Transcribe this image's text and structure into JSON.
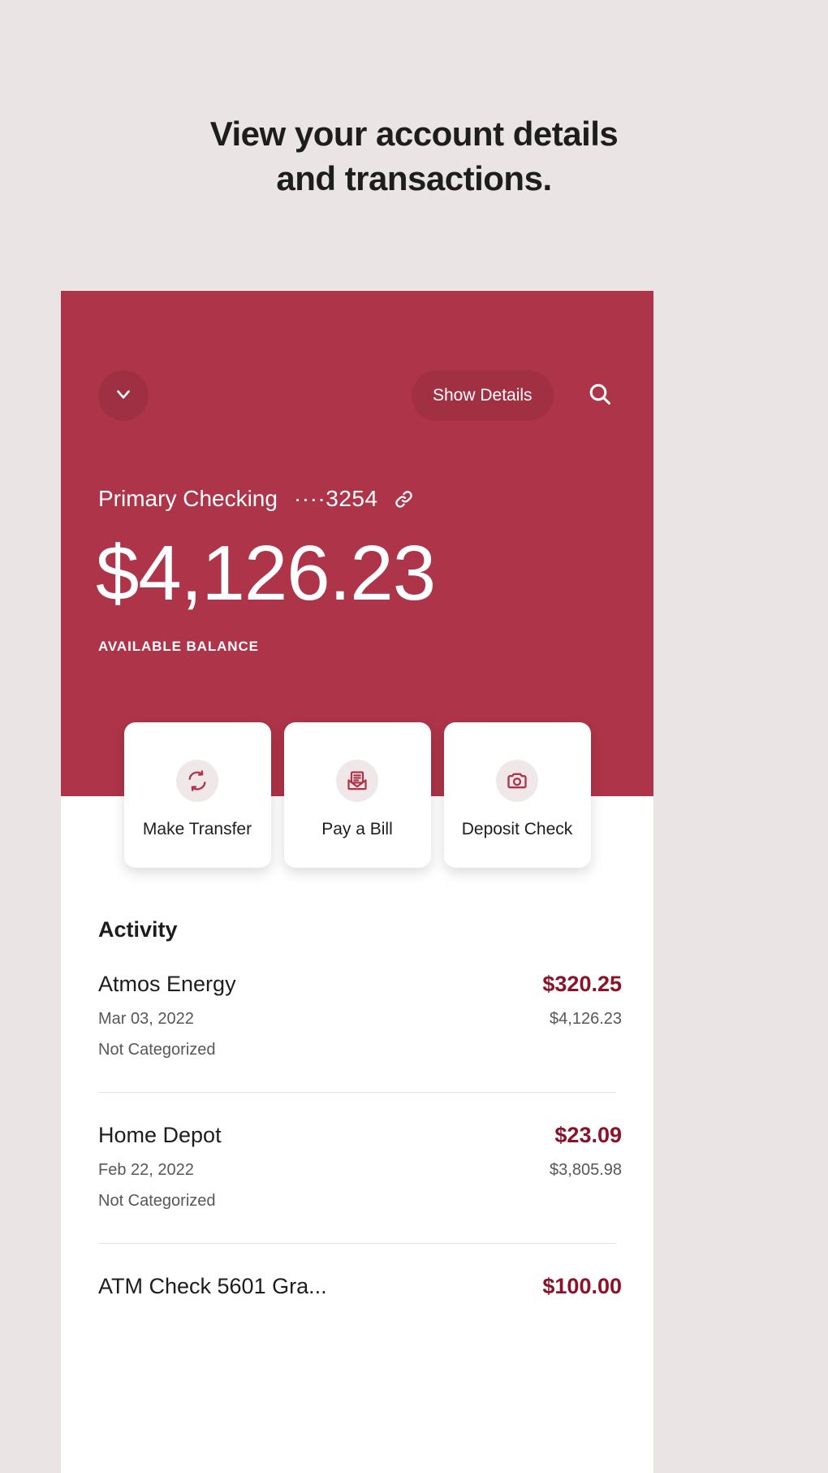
{
  "headline": {
    "line1": "View your account details",
    "line2": "and transactions."
  },
  "colors": {
    "page_background": "#EAE5E4",
    "card_red": "#AE3449",
    "amount_red": "#8C1228",
    "icon_circle": "#F0E7E8"
  },
  "account_card": {
    "toolbar": {
      "collapse_icon": "chevron-down-icon",
      "show_details_label": "Show Details",
      "search_icon": "search-icon"
    },
    "account_name": "Primary Checking",
    "account_mask": "····3254",
    "link_icon": "link-icon",
    "balance": "$4,126.23",
    "balance_label": "AVAILABLE BALANCE"
  },
  "quick_actions": [
    {
      "label": "Make Transfer",
      "icon": "transfer-arrows-icon"
    },
    {
      "label": "Pay a Bill",
      "icon": "envelope-bill-icon"
    },
    {
      "label": "Deposit Check",
      "icon": "camera-icon"
    }
  ],
  "activity": {
    "title": "Activity",
    "transactions": [
      {
        "name": "Atmos Energy",
        "amount": "$320.25",
        "date": "Mar 03, 2022",
        "running_balance": "$4,126.23",
        "category": "Not Categorized"
      },
      {
        "name": "Home Depot",
        "amount": "$23.09",
        "date": "Feb 22, 2022",
        "running_balance": "$3,805.98",
        "category": "Not Categorized"
      },
      {
        "name": "ATM Check 5601 Gra...",
        "amount": "$100.00",
        "date": "",
        "running_balance": "",
        "category": ""
      }
    ]
  }
}
